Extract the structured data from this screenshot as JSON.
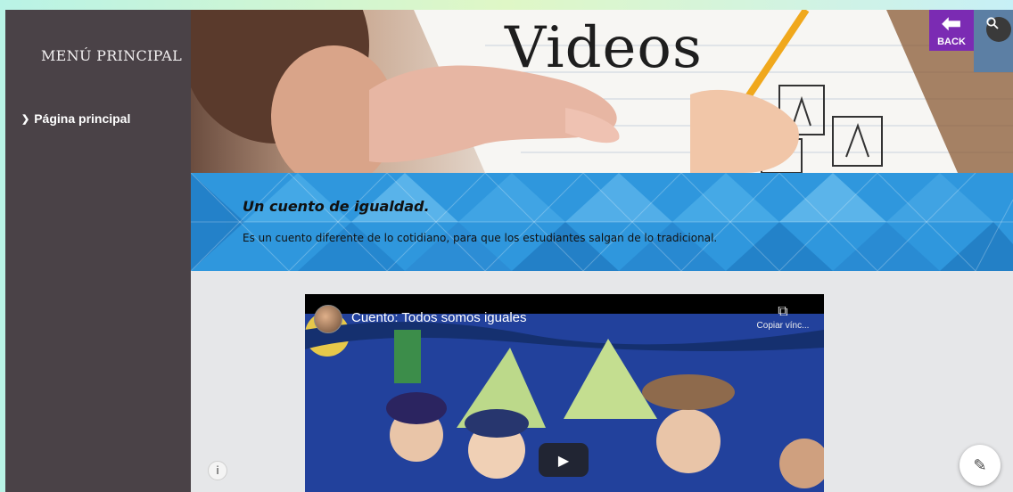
{
  "sidebar": {
    "title": "MENÚ PRINCIPAL",
    "items": [
      {
        "label": "Página principal",
        "icon": "chevron-down-icon"
      }
    ],
    "background": "#4a4247"
  },
  "header": {
    "title": "Videos",
    "back_label": "BACK",
    "back_icon": "arrow-left-icon",
    "back_color": "#7b2bb3",
    "search_icon": "search-icon"
  },
  "band": {
    "subtitle": "Un cuento de igualdad.",
    "description": "Es un cuento diferente de lo cotidiano, para que los estudiantes salgan de lo tradicional.",
    "color": "#2a8fd8"
  },
  "video": {
    "title": "Cuento: Todos somos iguales",
    "copy_label": "Copiar vínc...",
    "copy_icon": "copy-icon",
    "play_icon": "play-icon"
  },
  "floating": {
    "info_icon": "info-icon",
    "edit_icon": "pencil-icon"
  }
}
